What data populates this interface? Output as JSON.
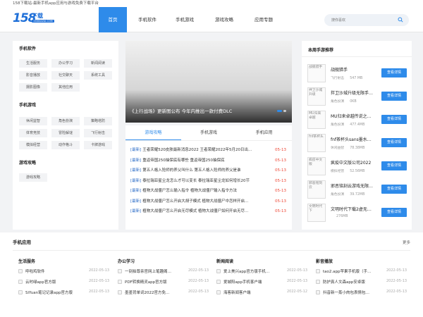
{
  "topbar": {
    "text": "158下载站-最新手机app应用与游戏免费下载平台"
  },
  "logo": {
    "num": "158",
    "dl": "下载",
    "domain": "158XIAZAI.COM"
  },
  "nav": [
    {
      "label": "首页",
      "active": true
    },
    {
      "label": "手机软件"
    },
    {
      "label": "手机游戏"
    },
    {
      "label": "游戏攻略"
    },
    {
      "label": "应用专题"
    }
  ],
  "search": {
    "placeholder": "搜你喜欢"
  },
  "left": {
    "software_title": "手机软件",
    "software_tags": [
      "生活服务",
      "办公学习",
      "新闻阅读",
      "影音播放",
      "社交聊天",
      "系统工具",
      "摄影图像",
      "其他应用"
    ],
    "games_title": "手机游戏",
    "game_tags": [
      "休闲益智",
      "角色扮演",
      "策略塔防",
      "体育竞技",
      "冒险解谜",
      "飞行射击",
      "模拟经营",
      "动作格斗",
      "卡牌游戏"
    ],
    "guide_title": "游戏攻略",
    "guide_tags": [
      "游戏攻略"
    ]
  },
  "banner": {
    "caption": "《上行战场》更新图公布 今年内推出一款付费DLC"
  },
  "news": {
    "tabs": [
      {
        "label": "游戏攻略",
        "active": true
      },
      {
        "label": "手机游戏"
      },
      {
        "label": "手机应用"
      }
    ],
    "items": [
      {
        "tag": "[最新]",
        "title": "王者荣耀520皮肤最新消息2022 王者荣耀2022年5月20日出…",
        "date": "05-13"
      },
      {
        "tag": "[最新]",
        "title": "重返帝国250抽保底有哪些 重返帝国250抽保底",
        "date": "05-13"
      },
      {
        "tag": "[最新]",
        "title": "第五人格入殓师的养父叫什么 第五人格入殓师的养父是谁",
        "date": "05-13"
      },
      {
        "tag": "[最新]",
        "title": "泰拉瑞亚星尘龙怎么才可以变长 泰拉瑞亚星尘龙如何增长20节",
        "date": "05-13"
      },
      {
        "tag": "[最新]",
        "title": "植物大战僵尸怎么输入指令 植物大战僵尸输入指令方法",
        "date": "05-13"
      },
      {
        "tag": "[最新]",
        "title": "植物大战僵尸怎么开启大胡子模式 植物大战僵尸中怎样开启…",
        "date": "05-13"
      },
      {
        "tag": "[最新]",
        "title": "植物大战僵尸怎么开启无尽模式 植物大战僵尸如何开启无尽…",
        "date": "05-13"
      }
    ]
  },
  "weekly": {
    "title": "本周手游推荐",
    "button": "查看详情",
    "items": [
      {
        "thumb": "战舰猎手",
        "name": "战舰猎手",
        "cat": "飞行射击",
        "size": "547 MB"
      },
      {
        "thumb": "拌卫沙城升级",
        "name": "拌卫沙城升级无限手…",
        "cat": "角色扮演",
        "size": "0KB"
      },
      {
        "thumb": "MU归来卓越",
        "name": "MU归来卓越传说之…",
        "cat": "角色扮演",
        "size": "477.4MB"
      },
      {
        "thumb": "fnf茶杯头",
        "name": "fnf茶杯头sans墨水…",
        "cat": "休闲益智",
        "size": "78.38MB"
      },
      {
        "thumb": "疯疫中文版",
        "name": "疯疫中文版公司2022",
        "cat": "模拟经营",
        "size": "52.56MB"
      },
      {
        "thumb": "邪恶铭刻云",
        "name": "邪恶铭刻云游戏无限…",
        "cat": "角色扮演",
        "size": "39.72MB"
      },
      {
        "thumb": "文明时代下",
        "name": "文明时代下载2虚无…",
        "cat": "",
        "size": "276MB"
      }
    ]
  },
  "apps": {
    "title": "手机应用",
    "more": "更多",
    "columns": [
      {
        "title": "生活服务",
        "items": [
          {
            "name": "呼啦鸡软件",
            "date": "2022-05-13"
          },
          {
            "name": "云时绿app官方版",
            "date": "2022-05-13"
          },
          {
            "name": "SiYuan笔记记录app官方版",
            "date": "2022-05-13"
          }
        ]
      },
      {
        "title": "办公学习",
        "items": [
          {
            "name": "一刻拍尊亲官网上笔趣阁…",
            "date": "2022-05-13"
          },
          {
            "name": "PDF转换精灵app官方版",
            "date": "2022-05-13"
          },
          {
            "name": "墨墨背单词2022官方免…",
            "date": "2022-05-13"
          }
        ]
      },
      {
        "title": "新闻阅读",
        "items": [
          {
            "name": "爱上美兴app官方版手机…",
            "date": "2022-05-13"
          },
          {
            "name": "爱城阳app手机客户端",
            "date": "2022-05-13"
          },
          {
            "name": "海客新闻客户端",
            "date": "2022-05-12"
          }
        ]
      },
      {
        "title": "影音播放",
        "items": [
          {
            "name": "tao2.app苹果手机版（手…",
            "date": "2022-05-13"
          },
          {
            "name": "防护真人文森app安卓版",
            "date": "2022-05-13"
          },
          {
            "name": "抖音新一蒸小肉包表情包…",
            "date": "2022-05-13"
          }
        ]
      }
    ]
  }
}
